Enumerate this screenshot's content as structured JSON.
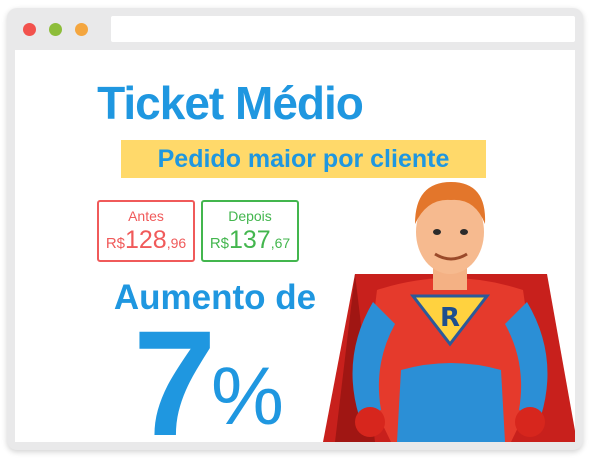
{
  "page": {
    "title": "Ticket Médio",
    "subtitle": "Pedido maior por cliente"
  },
  "comparison": {
    "before": {
      "label": "Antes",
      "currency": "R$",
      "integer": "128",
      "decimal": ",96"
    },
    "after": {
      "label": "Depois",
      "currency": "R$",
      "integer": "137",
      "decimal": ",67"
    }
  },
  "increase": {
    "label": "Aumento de",
    "value": "7",
    "unit": "%"
  },
  "hero": {
    "emblem_letter": "R"
  },
  "colors": {
    "accent_blue": "#1f97e0",
    "highlight_yellow": "#ffd96a",
    "before_red": "#f05a5a",
    "after_green": "#43b64e"
  }
}
